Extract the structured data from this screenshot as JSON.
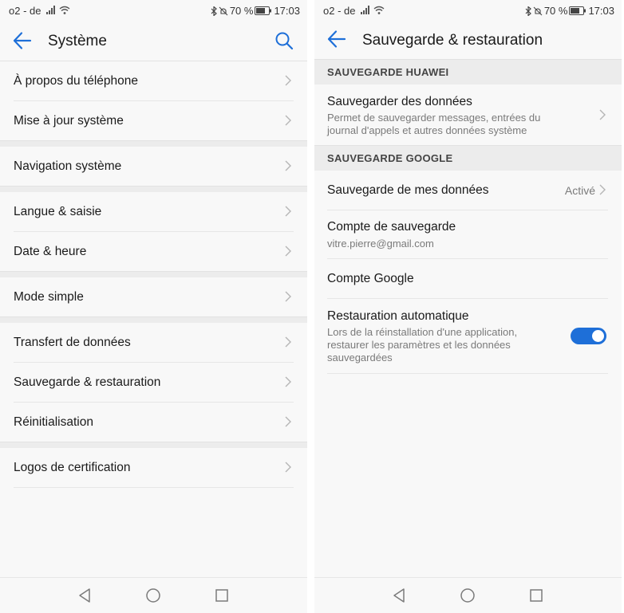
{
  "colors": {
    "accent": "#1e6fd8",
    "background": "#f8f8f8",
    "divider": "#e6e6e6",
    "section_bg": "#ececec"
  },
  "status_bar": {
    "carrier": "o2 - de",
    "battery": "70 %",
    "time": "17:03"
  },
  "left_screen": {
    "title": "Système",
    "groups": [
      [
        "À propos du téléphone",
        "Mise à jour système"
      ],
      [
        "Navigation système"
      ],
      [
        "Langue & saisie",
        "Date & heure"
      ],
      [
        "Mode simple"
      ],
      [
        "Transfert de données",
        "Sauvegarde & restauration",
        "Réinitialisation"
      ],
      [
        "Logos de certification"
      ]
    ]
  },
  "right_screen": {
    "title": "Sauvegarde & restauration",
    "section_huawei": "SAUVEGARDE HUAWEI",
    "huawei_backup": {
      "title": "Sauvegarder des données",
      "subtitle": "Permet de sauvegarder messages, entrées du journal d'appels et autres données système"
    },
    "section_google": "SAUVEGARDE GOOGLE",
    "my_data_backup": {
      "title": "Sauvegarde de mes données",
      "value": "Activé"
    },
    "backup_account": {
      "title": "Compte de sauvegarde",
      "value": "vitre.pierre@gmail.com"
    },
    "google_account": {
      "title": "Compte Google"
    },
    "auto_restore": {
      "title": "Restauration automatique",
      "subtitle": "Lors de la réinstallation d'une application, restaurer les paramètres et les données sauvegardées",
      "enabled": true
    }
  },
  "nav_icons": [
    "back-triangle-icon",
    "home-circle-icon",
    "recents-square-icon"
  ]
}
